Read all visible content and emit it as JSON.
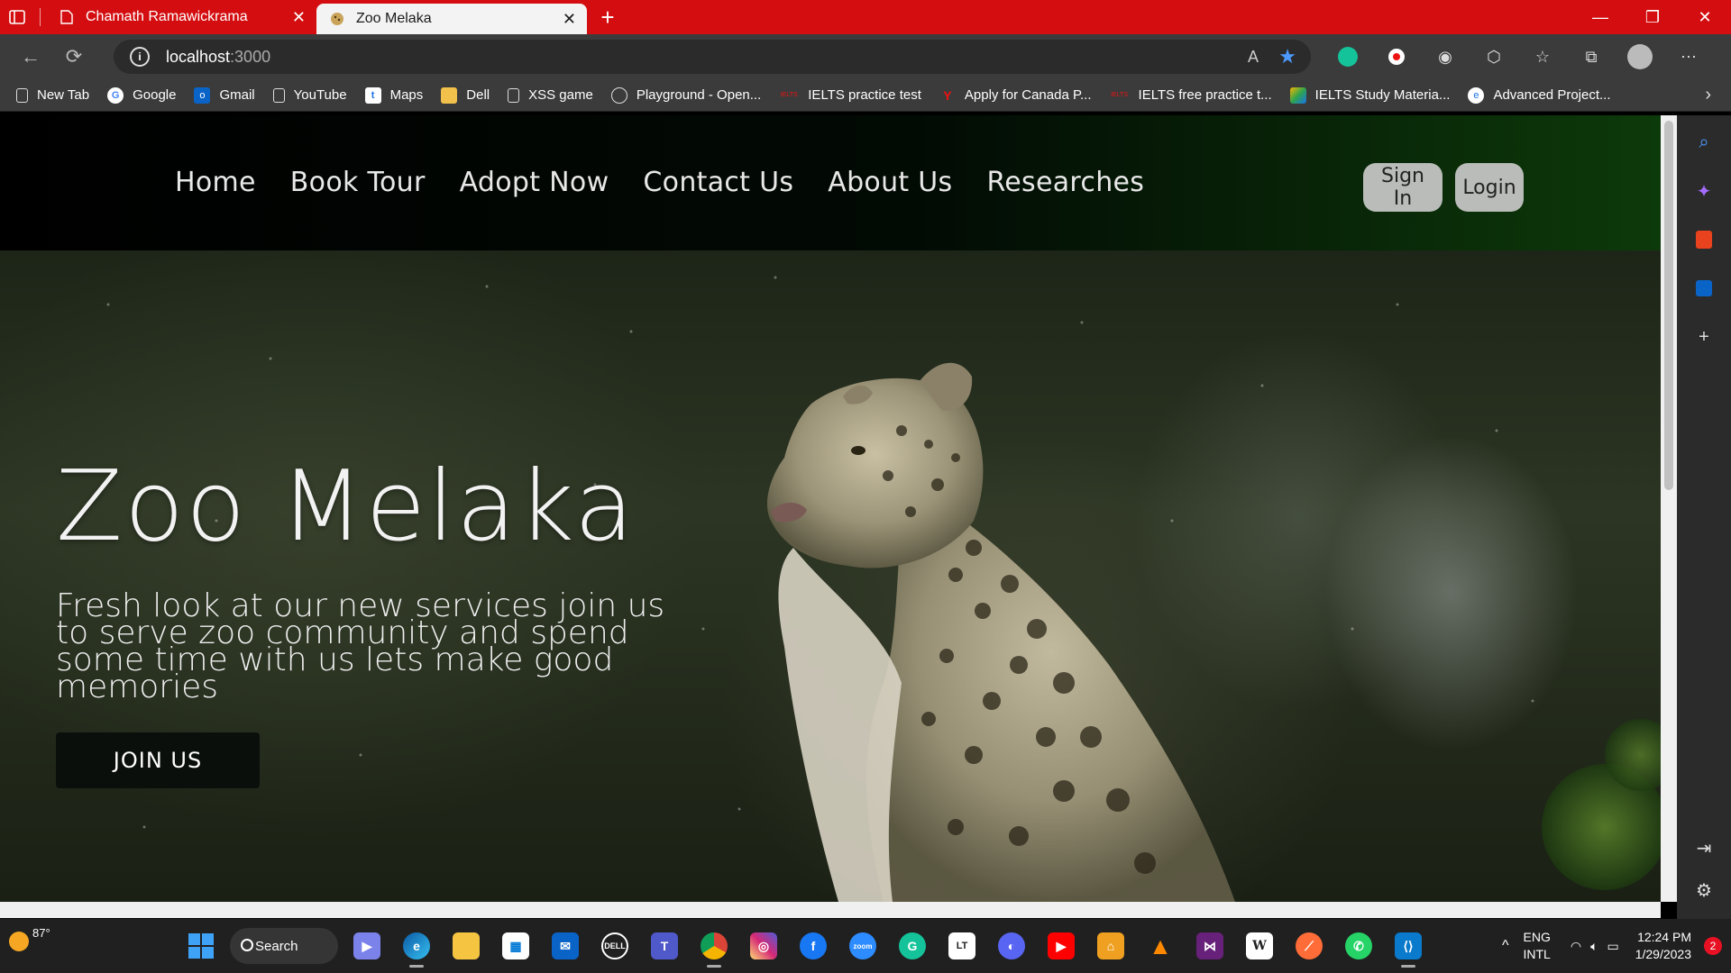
{
  "browser": {
    "tabs": [
      {
        "title": "Chamath Ramawickrama",
        "active": false
      },
      {
        "title": "Zoo Melaka",
        "active": true
      }
    ],
    "new_tab_symbol": "+",
    "close_symbol": "✕",
    "address": {
      "host": "localhost",
      "port": ":3000"
    },
    "bookmarks": [
      {
        "label": "New Tab",
        "icon": "page-icon"
      },
      {
        "label": "Google",
        "icon": "google-icon"
      },
      {
        "label": "Gmail",
        "icon": "outlook-icon"
      },
      {
        "label": "YouTube",
        "icon": "page-icon"
      },
      {
        "label": "Maps",
        "icon": "maps-icon"
      },
      {
        "label": "Dell",
        "icon": "folder-icon"
      },
      {
        "label": "XSS game",
        "icon": "page-icon"
      },
      {
        "label": "Playground - Open...",
        "icon": "openai-icon"
      },
      {
        "label": "IELTS practice test",
        "icon": "ielts-icon"
      },
      {
        "label": "Apply for Canada P...",
        "icon": "canada-icon"
      },
      {
        "label": "IELTS free practice t...",
        "icon": "ielts-icon"
      },
      {
        "label": "IELTS Study Materia...",
        "icon": "study-icon"
      },
      {
        "label": "Advanced Project...",
        "icon": "edge-icon"
      }
    ]
  },
  "site": {
    "menu": [
      "Home",
      "Book Tour",
      "Adopt Now",
      "Contact Us",
      "About Us",
      "Researches"
    ],
    "sign_in": "Sign In",
    "login": "Login",
    "hero_title": "Zoo Melaka",
    "hero_text": "Fresh look at our new services join us to serve zoo community and spend some time with us lets make good memories",
    "join": "JOIN US"
  },
  "taskbar": {
    "weather": "87°",
    "search": "Search",
    "lang_top": "ENG",
    "lang_bottom": "INTL",
    "time": "12:24 PM",
    "date": "1/29/2023",
    "notifications": "2"
  },
  "colors": {
    "tabbar": "#d40e10",
    "site_nav": "#000000",
    "button_gray": "#b9bcb8"
  }
}
